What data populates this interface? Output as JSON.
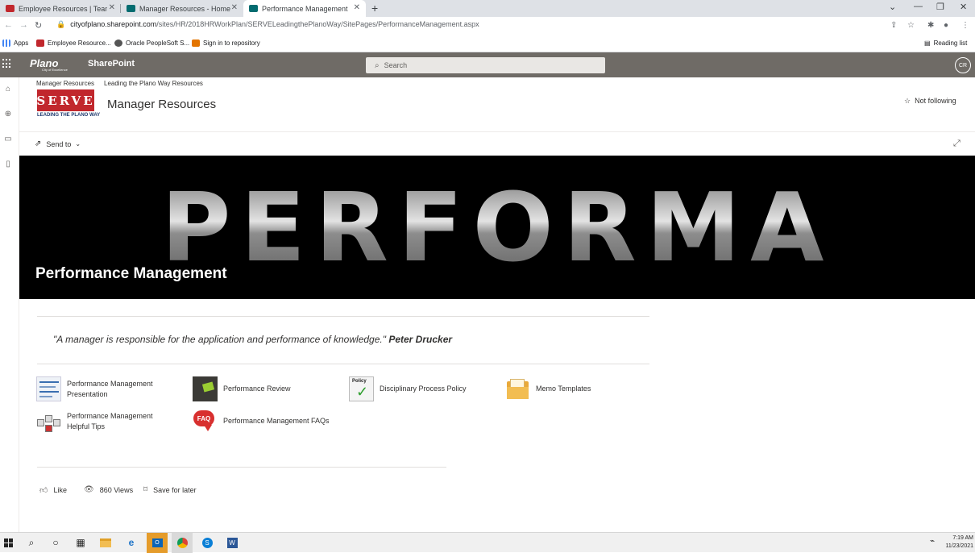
{
  "browser": {
    "tabs": [
      {
        "label": "Employee Resources | Team Plan",
        "active": false
      },
      {
        "label": "Manager Resources - Home",
        "active": false
      },
      {
        "label": "Performance Management",
        "active": true
      }
    ],
    "new_tab": "+",
    "url_host": "cityofplano.sharepoint.com",
    "url_path": "/sites/HR/2018HRWorkPlan/SERVELeadingthePlanoWay/SitePages/PerformanceManagement.aspx",
    "bookmarks": [
      "Apps",
      "Employee Resource...",
      "Oracle PeopleSoft S...",
      "Sign in to repository"
    ],
    "reading_list": "Reading list"
  },
  "suite": {
    "logo": "Plano",
    "logo_sub": "City of Excellence",
    "app_name": "SharePoint",
    "search_placeholder": "Search",
    "avatar": "CR"
  },
  "site": {
    "breadcrumbs": [
      "Manager Resources",
      "Leading the Plano Way Resources"
    ],
    "logo_text": "SERVE",
    "logo_tag": "LEADING THE PLANO WAY",
    "title": "Manager Resources",
    "follow": "Not following",
    "send_to": "Send to"
  },
  "hero": {
    "banner_text": "PERFORMANCE",
    "title": "Performance Management"
  },
  "quote": {
    "text": "\"A manager is responsible for the application and performance of knowledge.\"",
    "author": "Peter Drucker"
  },
  "quick_links": [
    {
      "label": "Performance Management Presentation",
      "icon": "presentation-thumbnail"
    },
    {
      "label": "Performance Review",
      "icon": "review-thumbnail"
    },
    {
      "label": "Disciplinary Process Policy",
      "icon": "policy-checkmark-thumbnail"
    },
    {
      "label": "Memo Templates",
      "icon": "folder-thumbnail"
    },
    {
      "label": "Performance Management Helpful Tips",
      "icon": "tips-blocks-thumbnail"
    },
    {
      "label": "Performance Management FAQs",
      "icon": "faq-bubble-thumbnail"
    }
  ],
  "footer": {
    "like": "Like",
    "views": "860 Views",
    "save": "Save for later"
  },
  "taskbar": {
    "time": "7:19 AM",
    "date": "11/23/2021"
  },
  "colors": {
    "suite_bar": "#6f6b66",
    "serve_red": "#c1272d",
    "hero_bg": "#000000"
  }
}
